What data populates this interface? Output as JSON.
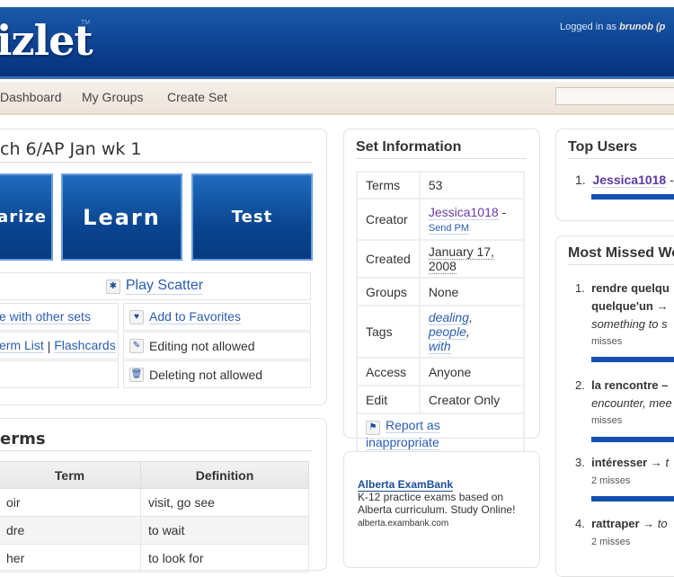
{
  "header": {
    "logo": "izlet",
    "tm": "TM",
    "logged_prefix": "Logged in as",
    "user": "brunob (p"
  },
  "nav": {
    "items": [
      "Dashboard",
      "My Groups",
      "Create Set"
    ],
    "search_placeholder": ""
  },
  "set": {
    "title": "ch 6/AP Jan wk 1",
    "modes": [
      "arize",
      "Learn",
      "Test"
    ],
    "scatter": "Play Scatter",
    "actions": {
      "combine": "e with other sets",
      "favorites": "Add to Favorites",
      "termlist": "erm List",
      "sep": "|",
      "flashcards": "Flashcards",
      "editing": "Editing not allowed",
      "deleting": "Deleting not allowed"
    }
  },
  "terms": {
    "title": "erms",
    "headers": [
      "Term",
      "Definition"
    ],
    "rows": [
      [
        "oir",
        "visit, go see"
      ],
      [
        "dre",
        "to wait"
      ],
      [
        "her",
        "to look for"
      ]
    ]
  },
  "info": {
    "title": "Set Information",
    "rows": {
      "terms_label": "Terms",
      "terms": "53",
      "creator_label": "Creator",
      "creator": "Jessica1018",
      "dash": "-",
      "send_pm": "Send PM",
      "created_label": "Created",
      "created": "January 17, 2008",
      "groups_label": "Groups",
      "groups": "None",
      "tags_label": "Tags",
      "tags": [
        "dealing",
        ", ",
        "people",
        ",",
        "with"
      ],
      "access_label": "Access",
      "access": "Anyone",
      "edit_label": "Edit",
      "edit": "Creator Only"
    },
    "report": "Report as inappropriate"
  },
  "ad": {
    "title": "Alberta ExamBank",
    "line1": "K-12 practice exams based on",
    "line2": "Alberta curriculum. Study Online!",
    "url": "alberta.exambank.com"
  },
  "top_users": {
    "title": "Top Users",
    "items": [
      {
        "num": "1.",
        "name": "Jessica1018",
        "suffix": "- "
      }
    ]
  },
  "missed": {
    "title": "Most Missed Wo",
    "items": [
      {
        "num": "1.",
        "word": "rendre quelqu",
        "word2": "quelque'un →",
        "def": "something to s",
        "misses": "misses"
      },
      {
        "num": "2.",
        "word": "la rencontre –",
        "def": "encounter, mee",
        "misses": "misses"
      },
      {
        "num": "3.",
        "word": "intéresser →",
        "def": "t",
        "misses": "2 misses"
      },
      {
        "num": "4.",
        "word": "rattraper →",
        "def": "to",
        "misses": "2 misses"
      }
    ]
  },
  "colors": {
    "brand": "#0a3c8c",
    "link": "#2a5db0",
    "visited": "#6a3aa0"
  }
}
